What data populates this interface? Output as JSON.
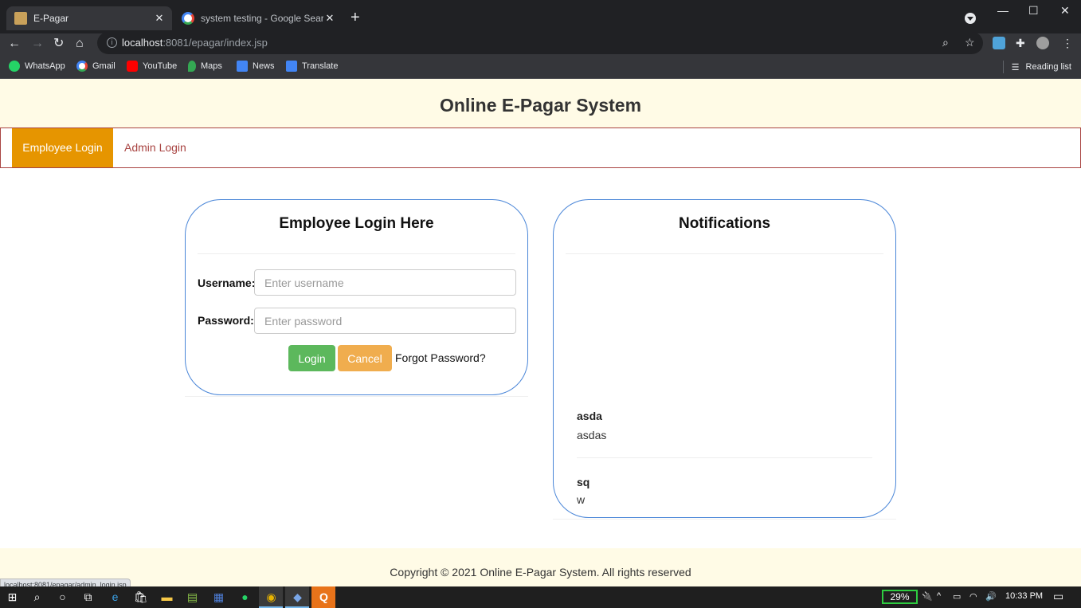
{
  "browser": {
    "tabs": [
      {
        "title": "E-Pagar",
        "active": true
      },
      {
        "title": "system testing - Google Search",
        "active": false
      }
    ],
    "url_host": "localhost",
    "url_path": ":8081/epagar/index.jsp",
    "bookmarks": [
      {
        "label": "WhatsApp",
        "icon": "whatsapp-icon",
        "color": "#25d366"
      },
      {
        "label": "Gmail",
        "icon": "google-icon",
        "color": "#ffffff"
      },
      {
        "label": "YouTube",
        "icon": "youtube-icon",
        "color": "#ff0000"
      },
      {
        "label": "Maps",
        "icon": "maps-icon",
        "color": "#34a853"
      },
      {
        "label": "News",
        "icon": "news-icon",
        "color": "#4285f4"
      },
      {
        "label": "Translate",
        "icon": "translate-icon",
        "color": "#4285f4"
      }
    ],
    "reading_list": "Reading list",
    "status_url": "localhost:8081/epagar/admin_login.jsp"
  },
  "page": {
    "title": "Online E-Pagar System",
    "nav": {
      "employee_login": "Employee Login",
      "admin_login": "Admin Login"
    },
    "login": {
      "heading": "Employee Login Here",
      "username_label": "Username:",
      "username_placeholder": "Enter username",
      "password_label": "Password:",
      "password_placeholder": "Enter password",
      "login_button": "Login",
      "cancel_button": "Cancel",
      "forgot_link": "Forgot Password?"
    },
    "notifications": {
      "heading": "Notifications",
      "items": [
        {
          "title": "asda",
          "body": "asdas"
        },
        {
          "title": "sq",
          "body": "w"
        }
      ]
    },
    "footer": "Copyright © 2021 Online E-Pagar System. All rights reserved"
  },
  "taskbar": {
    "battery": "29%",
    "time": "10:33 PM"
  },
  "colors": {
    "header_bg": "#fffbe6",
    "nav_active": "#e69500",
    "nav_border": "#a94442",
    "panel_border": "#4a86d8",
    "login_green": "#5cb85c",
    "cancel_orange": "#f0ad4e"
  }
}
